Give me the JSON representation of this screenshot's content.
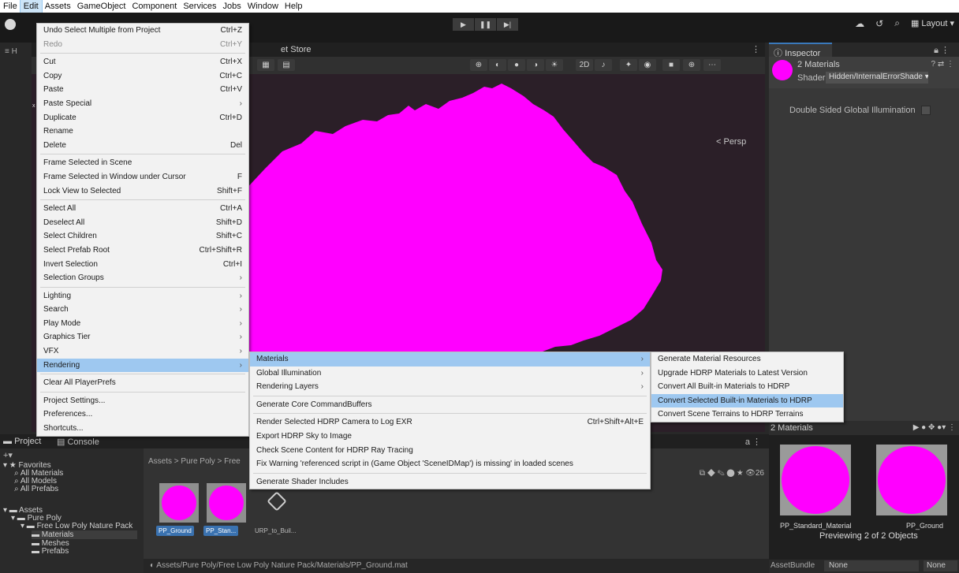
{
  "menubar": [
    "File",
    "Edit",
    "Assets",
    "GameObject",
    "Component",
    "Services",
    "Jobs",
    "Window",
    "Help"
  ],
  "toolbar": {
    "layout_label": "Layout"
  },
  "scene": {
    "tab_label": "et Store",
    "persp_label": "< Persp",
    "hier_tab": "≡ H"
  },
  "inspector": {
    "tab_label": "Inspector",
    "title": "2 Materials",
    "shader_label": "Shader",
    "shader_value": "Hidden/InternalErrorShade",
    "option_label": "Double Sided Global Illumination",
    "swatch_color": "#ff00ff"
  },
  "preview": {
    "title": "2 Materials",
    "item_a": "PP_Standard_Material",
    "item_b": "PP_Ground",
    "subtitle": "Previewing 2 of 2 Objects",
    "assetbundle_label": "AssetBundle",
    "assetbundle_value": "None",
    "variant_value": "None"
  },
  "project": {
    "tab_project": "Project",
    "tab_console": "Console",
    "breadcrumb": "Assets > Pure Poly > Free",
    "hidden_count": "26",
    "status_path": "Assets/Pure Poly/Free Low Poly Nature Pack/Materials/PP_Ground.mat",
    "tree": {
      "favorites": "Favorites",
      "all_materials": "All Materials",
      "all_models": "All Models",
      "all_prefabs": "All Prefabs",
      "assets": "Assets",
      "pure_poly": "Pure Poly",
      "nature_pack": "Free Low Poly Nature Pack",
      "materials": "Materials",
      "meshes": "Meshes",
      "prefabs": "Prefabs"
    },
    "thumbs": [
      "PP_Ground",
      "PP_Stan...",
      "URP_to_Buil..."
    ]
  },
  "edit_menu": {
    "undo": "Undo Select Multiple from Project",
    "undo_sc": "Ctrl+Z",
    "redo": "Redo",
    "redo_sc": "Ctrl+Y",
    "cut": "Cut",
    "cut_sc": "Ctrl+X",
    "copy": "Copy",
    "copy_sc": "Ctrl+C",
    "paste": "Paste",
    "paste_sc": "Ctrl+V",
    "paste_special": "Paste Special",
    "duplicate": "Duplicate",
    "duplicate_sc": "Ctrl+D",
    "rename": "Rename",
    "delete": "Delete",
    "delete_sc": "Del",
    "frame_selected": "Frame Selected in Scene",
    "frame_cursor": "Frame Selected in Window under Cursor",
    "frame_cursor_sc": "F",
    "lock_view": "Lock View to Selected",
    "lock_view_sc": "Shift+F",
    "select_all": "Select All",
    "select_all_sc": "Ctrl+A",
    "deselect_all": "Deselect All",
    "deselect_all_sc": "Shift+D",
    "select_children": "Select Children",
    "select_children_sc": "Shift+C",
    "select_prefab_root": "Select Prefab Root",
    "select_prefab_root_sc": "Ctrl+Shift+R",
    "invert_selection": "Invert Selection",
    "invert_selection_sc": "Ctrl+I",
    "selection_groups": "Selection Groups",
    "lighting": "Lighting",
    "search": "Search",
    "play_mode": "Play Mode",
    "graphics_tier": "Graphics Tier",
    "vfx": "VFX",
    "rendering": "Rendering",
    "clear_prefs": "Clear All PlayerPrefs",
    "project_settings": "Project Settings...",
    "preferences": "Preferences...",
    "shortcuts": "Shortcuts..."
  },
  "rendering_menu": {
    "materials": "Materials",
    "global_illumination": "Global Illumination",
    "rendering_layers": "Rendering Layers",
    "core_commandbuffers": "Generate Core CommandBuffers",
    "render_camera": "Render Selected HDRP Camera to Log EXR",
    "render_camera_sc": "Ctrl+Shift+Alt+E",
    "export_sky": "Export HDRP Sky to Image",
    "check_scene": "Check Scene Content for HDRP Ray Tracing",
    "fix_warning": "Fix Warning 'referenced script in (Game Object 'SceneIDMap') is missing' in loaded scenes",
    "shader_includes": "Generate Shader Includes"
  },
  "materials_menu": {
    "generate_resources": "Generate Material Resources",
    "upgrade_hdrp": "Upgrade HDRP Materials to Latest Version",
    "convert_all": "Convert All Built-in Materials to HDRP",
    "convert_selected": "Convert Selected Built-in Materials to HDRP",
    "convert_terrains": "Convert Scene Terrains to HDRP Terrains"
  },
  "colors": {
    "error_magenta": "#ff00ff",
    "menu_highlight": "#9ec8f0",
    "selection_blue": "#3a72b0"
  }
}
